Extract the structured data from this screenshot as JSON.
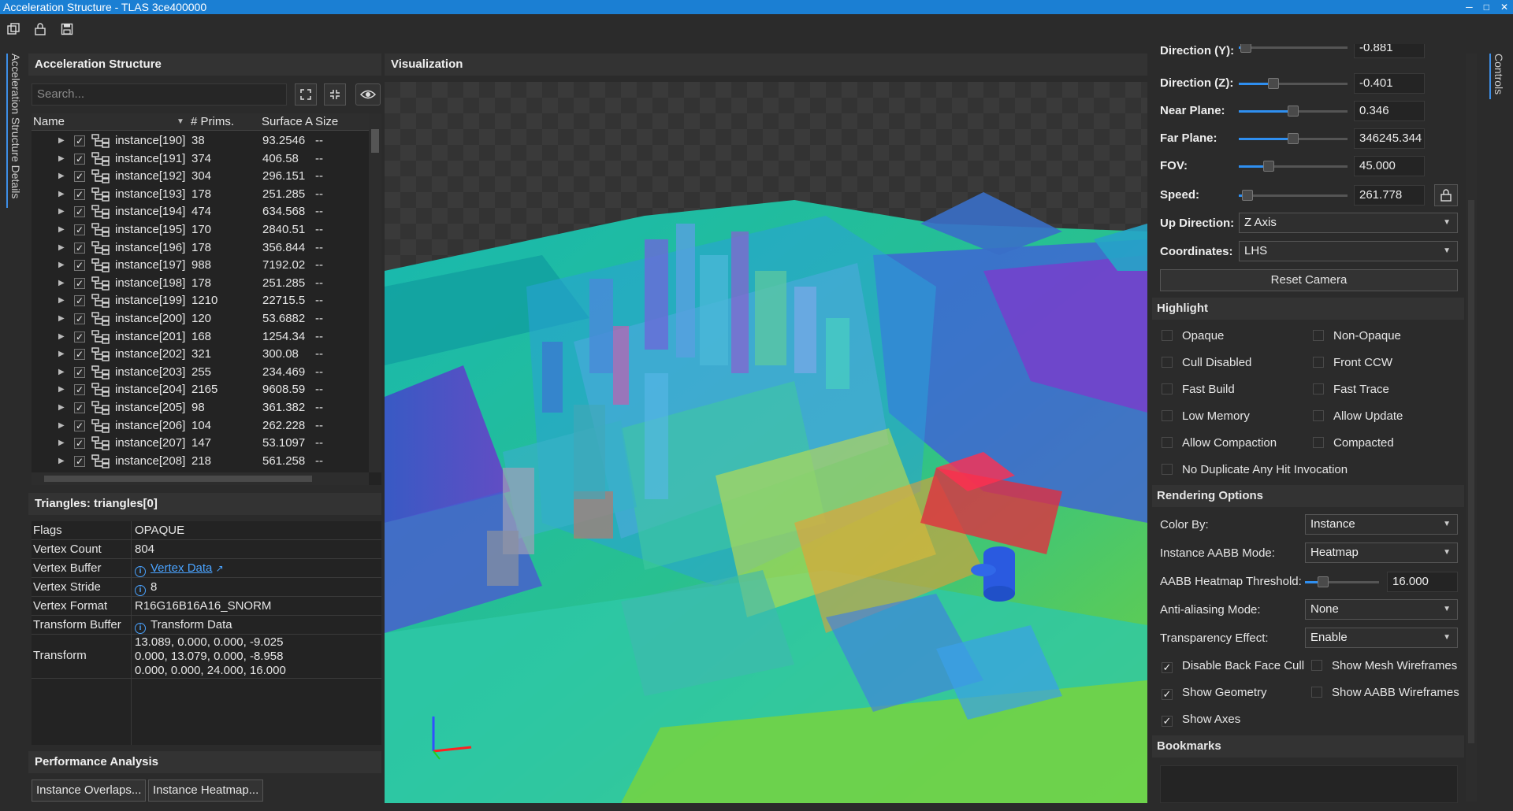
{
  "window": {
    "title": "Acceleration Structure - TLAS 3ce400000"
  },
  "side_tabs": {
    "left": "Acceleration Structure Details",
    "right": "Controls"
  },
  "left": {
    "header": "Acceleration Structure",
    "search_placeholder": "Search...",
    "columns": {
      "name": "Name",
      "prims": "# Prims.",
      "surface": "Surface A",
      "size": "Size"
    },
    "rows": [
      {
        "name": "instance[190]",
        "prims": "38",
        "surface": "93.2546",
        "size": "--"
      },
      {
        "name": "instance[191]",
        "prims": "374",
        "surface": "406.58",
        "size": "--"
      },
      {
        "name": "instance[192]",
        "prims": "304",
        "surface": "296.151",
        "size": "--"
      },
      {
        "name": "instance[193]",
        "prims": "178",
        "surface": "251.285",
        "size": "--"
      },
      {
        "name": "instance[194]",
        "prims": "474",
        "surface": "634.568",
        "size": "--"
      },
      {
        "name": "instance[195]",
        "prims": "170",
        "surface": "2840.51",
        "size": "--"
      },
      {
        "name": "instance[196]",
        "prims": "178",
        "surface": "356.844",
        "size": "--"
      },
      {
        "name": "instance[197]",
        "prims": "988",
        "surface": "7192.02",
        "size": "--"
      },
      {
        "name": "instance[198]",
        "prims": "178",
        "surface": "251.285",
        "size": "--"
      },
      {
        "name": "instance[199]",
        "prims": "1210",
        "surface": "22715.5",
        "size": "--"
      },
      {
        "name": "instance[200]",
        "prims": "120",
        "surface": "53.6882",
        "size": "--"
      },
      {
        "name": "instance[201]",
        "prims": "168",
        "surface": "1254.34",
        "size": "--"
      },
      {
        "name": "instance[202]",
        "prims": "321",
        "surface": "300.08",
        "size": "--"
      },
      {
        "name": "instance[203]",
        "prims": "255",
        "surface": "234.469",
        "size": "--"
      },
      {
        "name": "instance[204]",
        "prims": "2165",
        "surface": "9608.59",
        "size": "--"
      },
      {
        "name": "instance[205]",
        "prims": "98",
        "surface": "361.382",
        "size": "--"
      },
      {
        "name": "instance[206]",
        "prims": "104",
        "surface": "262.228",
        "size": "--"
      },
      {
        "name": "instance[207]",
        "prims": "147",
        "surface": "53.1097",
        "size": "--"
      },
      {
        "name": "instance[208]",
        "prims": "218",
        "surface": "561.258",
        "size": "--"
      }
    ],
    "details_header": "Triangles: triangles[0]",
    "props": {
      "flags": {
        "k": "Flags",
        "v": "OPAQUE"
      },
      "vertex_count": {
        "k": "Vertex Count",
        "v": "804"
      },
      "vertex_buffer": {
        "k": "Vertex Buffer",
        "v": "Vertex Data"
      },
      "vertex_stride": {
        "k": "Vertex Stride",
        "v": "8"
      },
      "vertex_format": {
        "k": "Vertex Format",
        "v": "R16G16B16A16_SNORM"
      },
      "transform_buffer": {
        "k": "Transform Buffer",
        "v": "Transform Data"
      },
      "transform": {
        "k": "Transform",
        "l1": "13.089, 0.000, 0.000, -9.025",
        "l2": "0.000, 13.079, 0.000, -8.958",
        "l3": "0.000, 0.000, 24.000, 16.000"
      }
    },
    "perf_header": "Performance Analysis",
    "btn_overlaps": "Instance Overlaps...",
    "btn_heatmap": "Instance Heatmap..."
  },
  "viz": {
    "header": "Visualization"
  },
  "controls": {
    "dir_y": {
      "label": "Direction (Y):",
      "value": "-0.881",
      "level": 0.02
    },
    "dir_z": {
      "label": "Direction (Z):",
      "value": "-0.401",
      "level": 0.3
    },
    "near": {
      "label": "Near Plane:",
      "value": "0.346",
      "level": 0.5
    },
    "far": {
      "label": "Far Plane:",
      "value": "346245.344",
      "level": 0.5
    },
    "fov": {
      "label": "FOV:",
      "value": "45.000",
      "level": 0.25
    },
    "speed": {
      "label": "Speed:",
      "value": "261.778",
      "level": 0.03
    },
    "up_dir": {
      "label": "Up Direction:",
      "value": "Z Axis"
    },
    "coords": {
      "label": "Coordinates:",
      "value": "LHS"
    },
    "reset": "Reset Camera",
    "highlight_header": "Highlight",
    "highlight": {
      "opaque": "Opaque",
      "non_opaque": "Non-Opaque",
      "cull_disabled": "Cull Disabled",
      "front_ccw": "Front CCW",
      "fast_build": "Fast Build",
      "fast_trace": "Fast Trace",
      "low_memory": "Low Memory",
      "allow_update": "Allow Update",
      "allow_compaction": "Allow Compaction",
      "compacted": "Compacted",
      "no_dup": "No Duplicate Any Hit Invocation"
    },
    "render_header": "Rendering Options",
    "color_by": {
      "label": "Color By:",
      "value": "Instance"
    },
    "aabb_mode": {
      "label": "Instance AABB Mode:",
      "value": "Heatmap"
    },
    "heat_thresh": {
      "label": "AABB Heatmap Threshold:",
      "value": "16.000",
      "level": 0.2
    },
    "aa_mode": {
      "label": "Anti-aliasing Mode:",
      "value": "None"
    },
    "transp": {
      "label": "Transparency Effect:",
      "value": "Enable"
    },
    "opts": {
      "disable_backface": "Disable Back Face Cull",
      "show_mesh_wire": "Show Mesh Wireframes",
      "show_geometry": "Show Geometry",
      "show_aabb_wire": "Show AABB Wireframes",
      "show_axes": "Show Axes"
    },
    "bookmarks_header": "Bookmarks"
  }
}
